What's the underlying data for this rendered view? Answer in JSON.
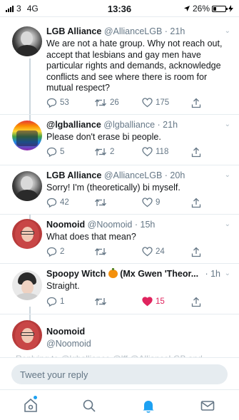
{
  "status_bar": {
    "carrier": "3",
    "network": "4G",
    "time": "13:36",
    "battery": "26%",
    "battery_level": 0.26
  },
  "tweets": [
    {
      "name": "LGB Alliance",
      "handle": "@AllianceLGB",
      "time": "· 21h",
      "text": "We are not a hate group. Why not reach out, accept that lesbians and gay men have particular rights and demands, acknowledge conflicts and see where there is room for mutual respect?",
      "replies": "53",
      "retweets": "26",
      "likes": "175"
    },
    {
      "name": "@lgballiance",
      "handle": "@lgballiance",
      "time": "· 21h",
      "text": "Please don't erase bi people.",
      "replies": "5",
      "retweets": "2",
      "likes": "118"
    },
    {
      "name": "LGB Alliance",
      "handle": "@AllianceLGB",
      "time": "· 20h",
      "text": "Sorry! I'm (theoretically) bi myself.",
      "replies": "42",
      "retweets": "",
      "likes": "9"
    },
    {
      "name": "Noomoid",
      "handle": "@Noomoid",
      "time": "· 15h",
      "text": "What does that mean?",
      "replies": "2",
      "retweets": "",
      "likes": "24"
    },
    {
      "name": "Spoopy Witch",
      "name_suffix": "(Mx Gwen 'Theor...",
      "handle": "",
      "time": "· 1h",
      "text": "Straight.",
      "replies": "1",
      "retweets": "",
      "likes": "15"
    },
    {
      "name": "Noomoid",
      "handle": "@Noomoid",
      "time": "",
      "text": "",
      "replies": "",
      "retweets": "",
      "likes": ""
    }
  ],
  "partial_text": "Replying to @lgballiance @lff @AllianceLGB and",
  "reply_bar": {
    "placeholder": "Tweet your reply"
  },
  "tab_bar": {
    "items": [
      "home-icon",
      "search-icon",
      "notifications-icon",
      "messages-icon"
    ]
  },
  "colors": {
    "accent": "#1da1f2",
    "like": "#e0245e",
    "muted": "#657786",
    "divider": "#e6ecf0"
  }
}
